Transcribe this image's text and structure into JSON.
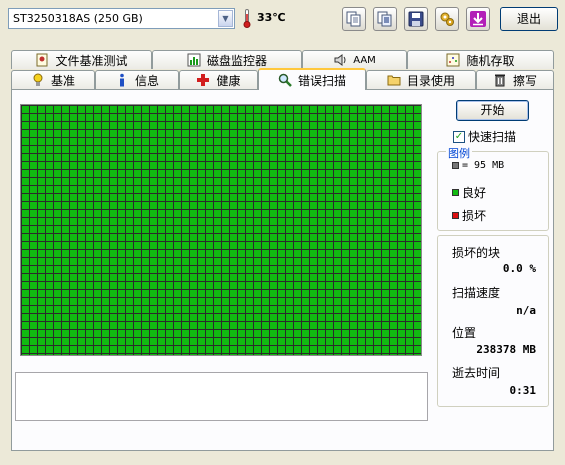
{
  "toolbar": {
    "drive": "ST3250318AS (250 GB)",
    "temperature": "33℃",
    "exit_label": "退出",
    "icons": [
      "copy-text-icon",
      "copy-all-icon",
      "save-icon",
      "options-icon",
      "download-icon"
    ]
  },
  "tabs_top": [
    {
      "label": "文件基准测试",
      "icon": "file-benchmark-icon"
    },
    {
      "label": "磁盘监控器",
      "icon": "disk-monitor-icon"
    },
    {
      "label": "AAM",
      "icon": "speaker-icon"
    },
    {
      "label": "随机存取",
      "icon": "random-access-icon"
    }
  ],
  "tabs_bottom": [
    {
      "label": "基准",
      "icon": "bulb-icon"
    },
    {
      "label": "信息",
      "icon": "info-icon"
    },
    {
      "label": "健康",
      "icon": "health-cross-icon"
    },
    {
      "label": "错误扫描",
      "icon": "magnifier-icon",
      "active": true
    },
    {
      "label": "目录使用",
      "icon": "folder-icon"
    },
    {
      "label": "擦写",
      "icon": "trash-icon"
    }
  ],
  "scan": {
    "start_label": "开始",
    "quick_scan_label": "快速扫描",
    "quick_scan_checked": true,
    "legend": {
      "title": "图例",
      "block_size": "= 95 MB",
      "good": "良好",
      "bad": "损坏"
    },
    "stats": {
      "bad_blocks_label": "损坏的块",
      "bad_blocks_value": "0.0 %",
      "speed_label": "扫描速度",
      "speed_value": "n/a",
      "position_label": "位置",
      "position_value": "238378 MB",
      "elapsed_label": "逝去时间",
      "elapsed_value": "0:31"
    }
  },
  "colors": {
    "good": "#11bb11",
    "bad": "#dd1111",
    "grid": "#2b2b2b"
  }
}
